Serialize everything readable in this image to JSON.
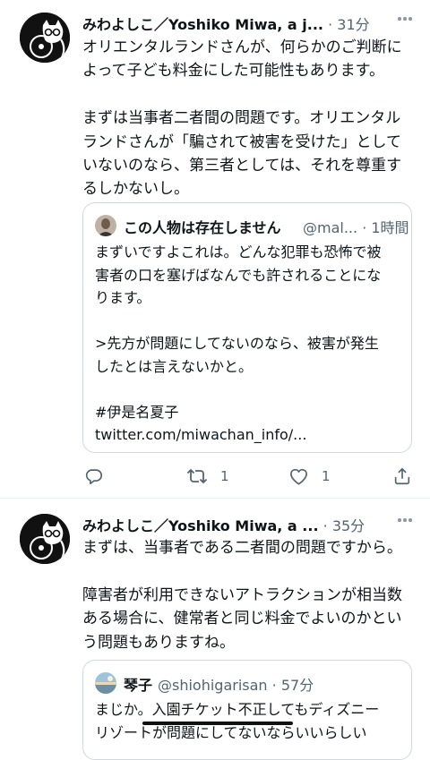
{
  "tweets": [
    {
      "author_name": "みわよしこ／Yoshiko Miwa, a j...",
      "separator": "·",
      "time": "31分",
      "text": "オリエンタルランドさんが、何らかのご判断に\nよって子ども料金にした可能性もあります。\n\nまずは当事者二者間の問題です。オリエンタル\nランドさんが「騙されて被害を受けた」として\nいないのなら、第三者としては、それを尊重す\nるしかないし。",
      "quote": {
        "name": "この人物は存在しません",
        "handle": "@mal...",
        "separator": "·",
        "time": "1時間",
        "text": "まずいですよこれは。どんな犯罪も恐怖で被\n害者の口を塞げばなんでも許されることにな\nります。\n\n>先方が問題にしてないのなら、被害が発生\nしたとは言えないかと。\n\n#伊是名夏子\ntwitter.com/miwachan_info/..."
      },
      "actions": {
        "reply_count": "",
        "retweet_count": "1",
        "like_count": "1"
      }
    },
    {
      "author_name": "みわよしこ／Yoshiko Miwa, a ...",
      "separator": "·",
      "time": "35分",
      "text": "まずは、当事者である二者間の問題ですから。\n\n障害者が利用できないアトラクションが相当数\nある場合に、健常者と同じ料金でよいのかとい\nう問題もありますね。",
      "quote": {
        "name": "琴子",
        "handle": "@shiohigarisan",
        "separator": "·",
        "time": "57分",
        "text": "まじか。入園チケット不正してもディズニー\nリゾートが問題にしてないならいいらしい"
      }
    }
  ],
  "icons": [
    "avatar-cat-icon",
    "more-icon",
    "reply-icon",
    "retweet-icon",
    "like-icon",
    "share-icon"
  ],
  "colors": {
    "text": "#0f1419",
    "secondary": "#536471",
    "border": "#cfd9de"
  }
}
